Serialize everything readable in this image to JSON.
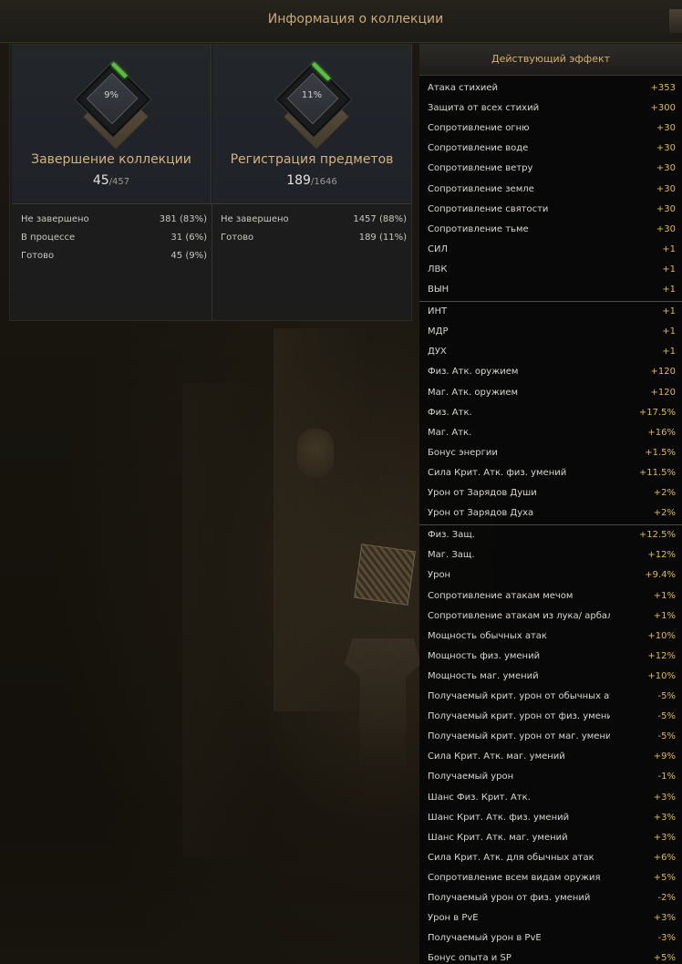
{
  "window": {
    "title": "Информация о коллекции"
  },
  "cards": [
    {
      "percent": "9%",
      "progress": 0.09,
      "title": "Завершение коллекции",
      "count": "45",
      "total": "/457",
      "stats": [
        {
          "label": "Не завершено",
          "value": "381 (83%)"
        },
        {
          "label": "В процессе",
          "value": "31 (6%)"
        },
        {
          "label": "Готово",
          "value": "45 (9%)"
        }
      ]
    },
    {
      "percent": "11%",
      "progress": 0.11,
      "title": "Регистрация предметов",
      "count": "189",
      "total": "/1646",
      "stats": [
        {
          "label": "Не завершено",
          "value": "1457 (88%)"
        },
        {
          "label": "Готово",
          "value": "189 (11%)"
        }
      ]
    }
  ],
  "effects": {
    "title": "Действующий эффект",
    "colors": {
      "value": "#e2b94e",
      "label": "#d8d6d0"
    },
    "groups": [
      [
        {
          "label": "Атака стихией",
          "value": "+353"
        },
        {
          "label": "Защита от всех стихий",
          "value": "+300"
        },
        {
          "label": "Сопротивление огню",
          "value": "+30"
        },
        {
          "label": "Сопротивление воде",
          "value": "+30"
        },
        {
          "label": "Сопротивление ветру",
          "value": "+30"
        },
        {
          "label": "Сопротивление земле",
          "value": "+30"
        },
        {
          "label": "Сопротивление святости",
          "value": "+30"
        },
        {
          "label": "Сопротивление тьме",
          "value": "+30"
        },
        {
          "label": "СИЛ",
          "value": "+1"
        },
        {
          "label": "ЛВК",
          "value": "+1"
        },
        {
          "label": "ВЫН",
          "value": "+1"
        }
      ],
      [
        {
          "label": "ИНТ",
          "value": "+1"
        },
        {
          "label": "МДР",
          "value": "+1"
        },
        {
          "label": "ДУХ",
          "value": "+1"
        },
        {
          "label": "Физ. Атк. оружием",
          "value": "+120"
        },
        {
          "label": "Маг. Атк. оружием",
          "value": "+120"
        },
        {
          "label": "Физ. Атк.",
          "value": "+17.5%"
        },
        {
          "label": "Маг. Атк.",
          "value": "+16%"
        },
        {
          "label": "Бонус энергии",
          "value": "+1.5%"
        },
        {
          "label": "Сила Крит. Атк. физ. умений",
          "value": "+11.5%"
        },
        {
          "label": "Урон от Зарядов Души",
          "value": "+2%"
        },
        {
          "label": "Урон от Зарядов Духа",
          "value": "+2%"
        }
      ],
      [
        {
          "label": "Физ. Защ.",
          "value": "+12.5%"
        },
        {
          "label": "Маг. Защ.",
          "value": "+12%"
        },
        {
          "label": "Урон",
          "value": "+9.4%"
        },
        {
          "label": "Сопротивление атакам мечом",
          "value": "+1%"
        },
        {
          "label": "Сопротивление атакам из лука/ арбале",
          "value": "+1%"
        },
        {
          "label": "Мощность обычных атак",
          "value": "+10%"
        },
        {
          "label": "Мощность физ. умений",
          "value": "+12%"
        },
        {
          "label": "Мощность маг. умений",
          "value": "+10%"
        },
        {
          "label": "Получаемый крит. урон от обычных ата",
          "value": "-5%"
        },
        {
          "label": "Получаемый крит. урон от физ. умений",
          "value": "-5%"
        },
        {
          "label": "Получаемый крит. урон от маг. умений",
          "value": "-5%"
        },
        {
          "label": "Сила Крит. Атк. маг. умений",
          "value": "+9%"
        },
        {
          "label": "Получаемый урон",
          "value": "-1%"
        },
        {
          "label": "Шанс Физ. Крит. Атк.",
          "value": "+3%"
        },
        {
          "label": "Шанс Крит. Атк. физ. умений",
          "value": "+3%"
        },
        {
          "label": "Шанс Крит. Атк. маг. умений",
          "value": "+3%"
        },
        {
          "label": "Сила Крит. Атк. для обычных атак",
          "value": "+6%"
        },
        {
          "label": "Сопротивление всем видам оружия",
          "value": "+5%"
        },
        {
          "label": "Получаемый урон от физ. умений",
          "value": "-2%"
        },
        {
          "label": "Урон в PvE",
          "value": "+3%"
        },
        {
          "label": "Получаемый урон в PvE",
          "value": "-3%"
        },
        {
          "label": "Бонус опыта и SP",
          "value": "+5%"
        }
      ]
    ]
  }
}
